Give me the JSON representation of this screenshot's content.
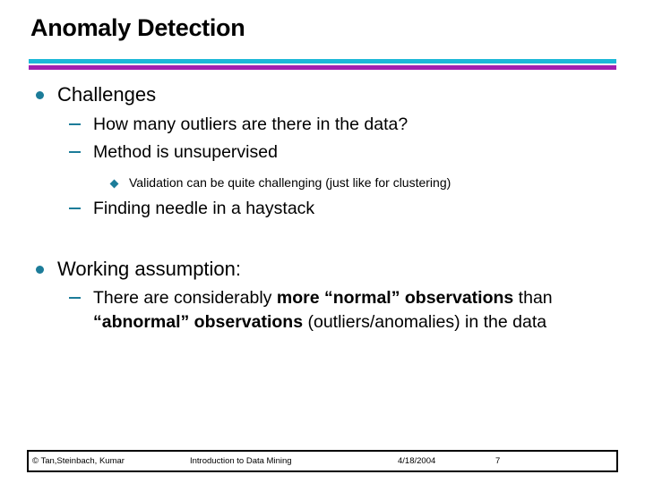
{
  "slide": {
    "title": "Anomaly Detection",
    "theme": {
      "accent_cyan": "#1BB8D8",
      "accent_purple": "#A020B0",
      "bullet_teal": "#1C7C99",
      "text_color": "#000000",
      "background": "#ffffff"
    },
    "sections": [
      {
        "heading": "Challenges",
        "bullet_icon": "filled-circle-bullet",
        "items": [
          {
            "level": 2,
            "icon": "dash-bullet",
            "text": "How many outliers are there in the data?"
          },
          {
            "level": 2,
            "icon": "dash-bullet",
            "text": "Method is unsupervised"
          },
          {
            "level": 3,
            "icon": "diamond-bullet",
            "text": "Validation can be quite challenging (just like for clustering)"
          },
          {
            "level": 2,
            "icon": "dash-bullet",
            "text": "Finding needle in a haystack"
          }
        ]
      },
      {
        "heading": "Working assumption:",
        "bullet_icon": "filled-circle-bullet",
        "items": [
          {
            "level": 2,
            "icon": "dash-bullet",
            "runs": [
              {
                "text": "There are considerably ",
                "bold": false
              },
              {
                "text": "more “normal” observations",
                "bold": true
              },
              {
                "text": " than ",
                "bold": false
              },
              {
                "text": "“abnormal” observations",
                "bold": true
              },
              {
                "text": " (outliers/anomalies) in the data",
                "bold": false
              }
            ]
          }
        ]
      }
    ]
  },
  "footer": {
    "copyright": "© Tan,Steinbach, Kumar",
    "subject": "Introduction to Data Mining",
    "date": "4/18/2004",
    "page_number": "7"
  }
}
